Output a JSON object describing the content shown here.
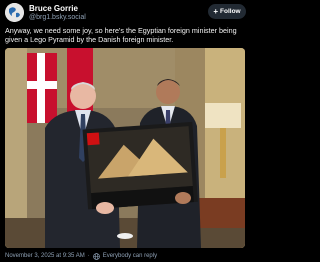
{
  "post": {
    "author": {
      "display_name": "Bruce Gorrie",
      "handle": "@brg1.bsky.social"
    },
    "follow_label": "Follow",
    "text": "Anyway, we need some joy, so here's the Egyptian foreign minister being given a Lego Pyramid by the Danish foreign minister.",
    "timestamp": "November 3, 2025 at 9:35 AM",
    "reply_setting": "Everybody can reply"
  },
  "icons": {
    "avatar": "globe-avatar-icon",
    "follow": "plus-icon",
    "reply_setting": "globe-icon"
  },
  "colors": {
    "background": "#000000",
    "handle_text": "#8ea0b4",
    "follow_button": "#222a33"
  }
}
